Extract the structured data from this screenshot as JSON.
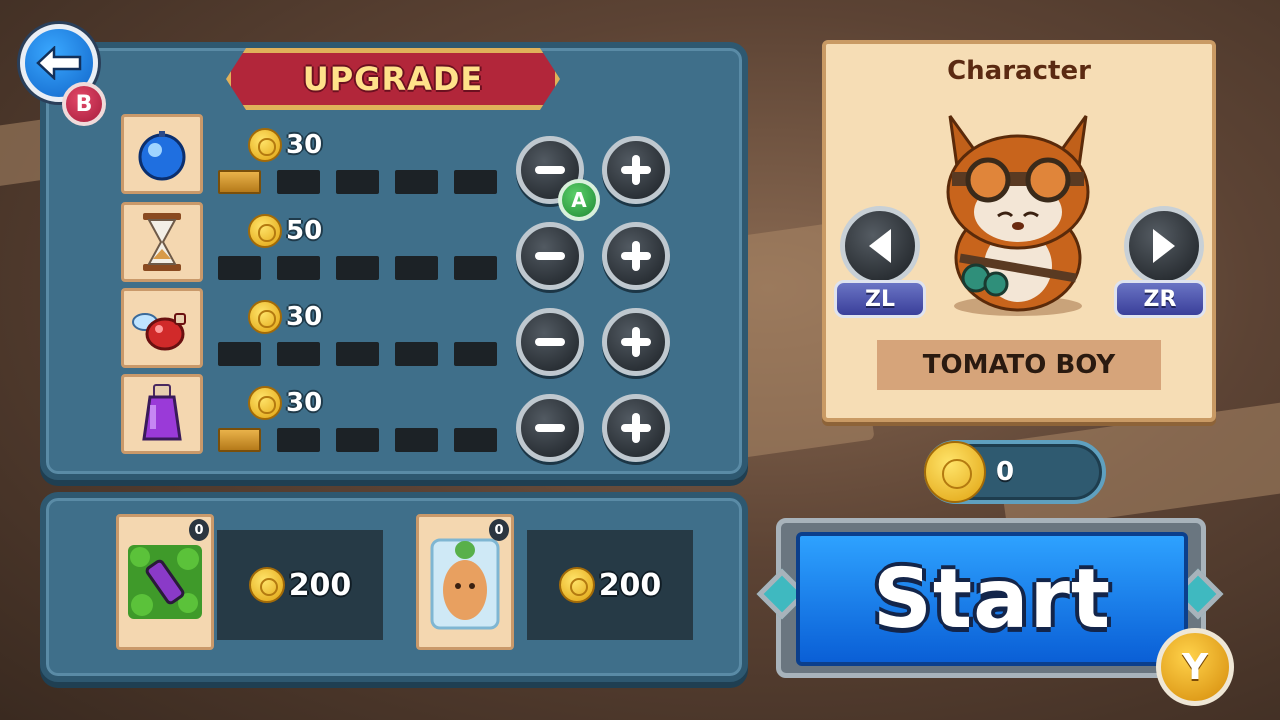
{
  "screen": {
    "back_button_badge": "B",
    "title": "UPGRADE"
  },
  "upgrades": [
    {
      "icon": "blue-orb-icon",
      "cost": "30",
      "level": 1,
      "max_level": 5
    },
    {
      "icon": "hourglass-icon",
      "cost": "50",
      "level": 0,
      "max_level": 5
    },
    {
      "icon": "winged-potion-icon",
      "cost": "30",
      "level": 0,
      "max_level": 5
    },
    {
      "icon": "purple-potion-icon",
      "cost": "30",
      "level": 1,
      "max_level": 5
    }
  ],
  "upgrade_controls": {
    "selected_button_badge": "A"
  },
  "shop": [
    {
      "icon": "potion-in-leaves-icon",
      "owned": "0",
      "price": "200"
    },
    {
      "icon": "frozen-carrot-icon",
      "owned": "0",
      "price": "200"
    }
  ],
  "character": {
    "heading": "Character",
    "name": "TOMATO BOY",
    "prev_label": "ZL",
    "next_label": "ZR"
  },
  "wallet": {
    "coins": "0"
  },
  "start": {
    "label": "Start",
    "badge": "Y"
  },
  "colors": {
    "panel": "#3f6f8a",
    "banner": "#b2263a",
    "start_button": "#1a7fe8",
    "coin": "#f2c230"
  }
}
